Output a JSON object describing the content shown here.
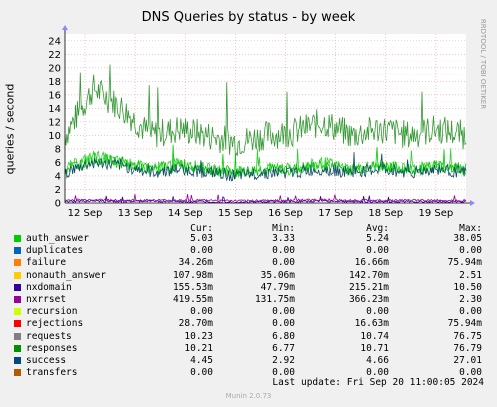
{
  "chart_data": {
    "type": "line",
    "title": "DNS Queries by status - by week",
    "ylabel": "queries / second",
    "ylim": [
      0,
      25
    ],
    "yticks": [
      "0",
      "2",
      "4",
      "6",
      "8",
      "10",
      "12",
      "14",
      "16",
      "18",
      "20",
      "22",
      "24"
    ],
    "xticks": [
      "12 Sep",
      "13 Sep",
      "14 Sep",
      "15 Sep",
      "16 Sep",
      "17 Sep",
      "18 Sep",
      "19 Sep"
    ],
    "grid": true,
    "series_approx": [
      {
        "name": "requests",
        "color": "#339933",
        "values": [
          10,
          17,
          14,
          10,
          11,
          10,
          9,
          10,
          10.5,
          12,
          10,
          11,
          10,
          11,
          10
        ]
      },
      {
        "name": "responses",
        "color": "#33cc33",
        "values": [
          5,
          7,
          6,
          5,
          6,
          5,
          4.5,
          5,
          5,
          6,
          5,
          5.5,
          5,
          5.5,
          5
        ]
      },
      {
        "name": "auth_answer",
        "color": "#00cc00",
        "values": [
          5,
          6.5,
          6,
          5,
          5.5,
          5,
          4.5,
          5,
          5,
          5.5,
          5,
          5.5,
          5,
          5.5,
          5
        ]
      },
      {
        "name": "success",
        "color": "#0f4c67",
        "values": [
          4.5,
          6,
          5.5,
          4.5,
          5,
          4.5,
          4,
          4.5,
          4.5,
          5,
          4.5,
          5,
          4.5,
          5,
          4.5
        ]
      },
      {
        "name": "nxdomain",
        "color": "#330099",
        "values": [
          0.2,
          0.3,
          0.2,
          0.3,
          0.2,
          0.2,
          0.1,
          0.2,
          0.2,
          0.3,
          0.2,
          0.2,
          0.2,
          0.2,
          0.2
        ]
      },
      {
        "name": "nxrrset",
        "color": "#990099",
        "values": [
          0.4,
          0.5,
          0.4,
          0.4,
          0.4,
          0.4,
          0.3,
          0.4,
          0.4,
          0.5,
          0.4,
          0.4,
          0.4,
          0.4,
          0.4
        ]
      }
    ],
    "legend_header": [
      "Cur:",
      "Min:",
      "Avg:",
      "Max:"
    ],
    "legend": [
      {
        "name": "auth_answer",
        "color": "#00cc00",
        "cur": "5.03",
        "min": "3.33",
        "avg": "5.24",
        "max": "38.05"
      },
      {
        "name": "duplicates",
        "color": "#0066b3",
        "cur": "0.00",
        "min": "0.00",
        "avg": "0.00",
        "max": "0.00"
      },
      {
        "name": "failure",
        "color": "#ff8000",
        "cur": "34.26m",
        "min": "0.00",
        "avg": "16.66m",
        "max": "75.94m"
      },
      {
        "name": "nonauth_answer",
        "color": "#ffcc00",
        "cur": "107.98m",
        "min": "35.06m",
        "avg": "142.70m",
        "max": "2.51"
      },
      {
        "name": "nxdomain",
        "color": "#330099",
        "cur": "155.53m",
        "min": "47.79m",
        "avg": "215.21m",
        "max": "10.50"
      },
      {
        "name": "nxrrset",
        "color": "#990099",
        "cur": "419.55m",
        "min": "131.75m",
        "avg": "366.23m",
        "max": "2.30"
      },
      {
        "name": "recursion",
        "color": "#ccff00",
        "cur": "0.00",
        "min": "0.00",
        "avg": "0.00",
        "max": "0.00"
      },
      {
        "name": "rejections",
        "color": "#ff0000",
        "cur": "28.70m",
        "min": "0.00",
        "avg": "16.63m",
        "max": "75.94m"
      },
      {
        "name": "requests",
        "color": "#808080",
        "cur": "10.23",
        "min": "6.80",
        "avg": "10.74",
        "max": "76.75"
      },
      {
        "name": "responses",
        "color": "#008f00",
        "cur": "10.21",
        "min": "6.77",
        "avg": "10.71",
        "max": "76.79"
      },
      {
        "name": "success",
        "color": "#00487d",
        "cur": "4.45",
        "min": "2.92",
        "avg": "4.66",
        "max": "27.01"
      },
      {
        "name": "transfers",
        "color": "#b35a00",
        "cur": "0.00",
        "min": "0.00",
        "avg": "0.00",
        "max": "0.00"
      }
    ]
  },
  "footer": {
    "last_update": "Last update: Fri Sep 20 11:00:05 2024",
    "munin": "Munin 2.0.73",
    "rrdtool": "RRDTOOL / TOBI OETIKER"
  }
}
